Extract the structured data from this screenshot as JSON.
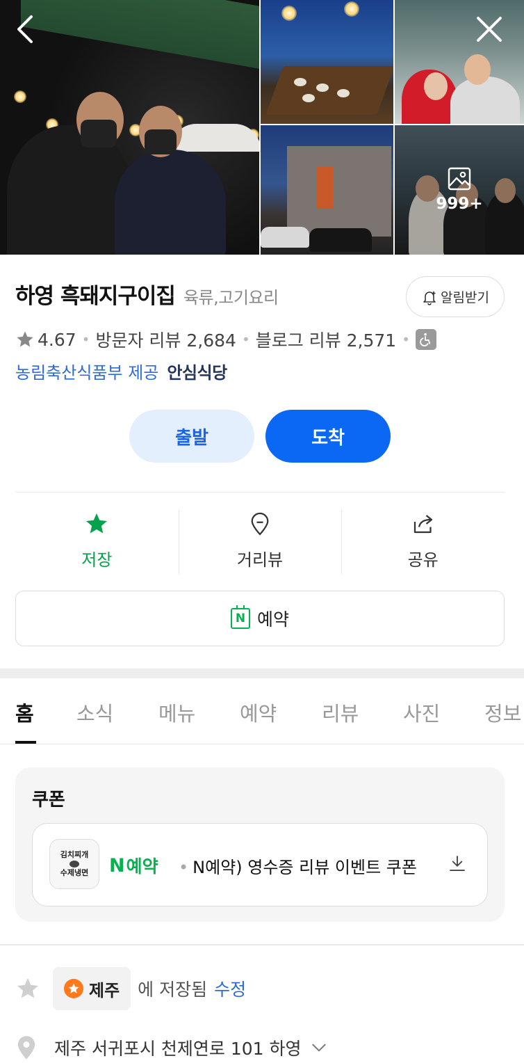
{
  "header": {
    "back_icon": "chevron-left-icon",
    "close_icon": "close-icon",
    "photo_count": "999+"
  },
  "place": {
    "name": "하영 흑돼지구이집",
    "category": "육류,고기요리",
    "notify_label": "알림받기",
    "rating": "4.67",
    "visitor_reviews": "방문자 리뷰 2,684",
    "blog_reviews": "블로그 리뷰 2,571",
    "provider": "농림축산식품부 제공",
    "safe_badge": "안심식당"
  },
  "directions": {
    "depart": "출발",
    "arrive": "도착"
  },
  "actions": {
    "save": "저장",
    "streetview": "거리뷰",
    "share": "공유"
  },
  "reserve_label": "예약",
  "tabs": [
    "홈",
    "소식",
    "메뉴",
    "예약",
    "리뷰",
    "사진",
    "정보"
  ],
  "coupon": {
    "title": "쿠폰",
    "thumb_line1": "김치찌개",
    "thumb_line2": "수제냉면",
    "brand": "예약",
    "text": "N예약) 영수증 리뷰 이벤트 쿠폰"
  },
  "saved": {
    "folder": "제주",
    "text": "에 저장됨",
    "edit": "수정"
  },
  "address": "제주 서귀포시 천제연로 101 하영",
  "colors": {
    "primary_blue": "#0a68f5",
    "green": "#06a14c",
    "link_blue": "#2f6bd6"
  }
}
